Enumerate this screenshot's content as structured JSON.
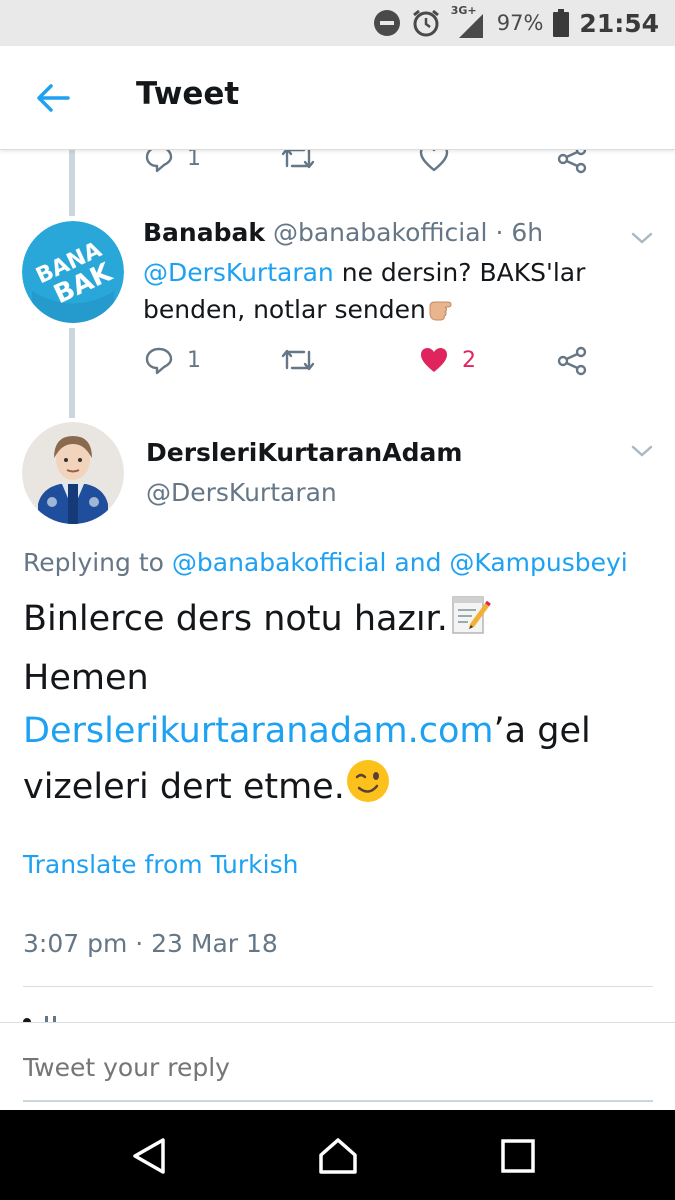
{
  "status_bar": {
    "network": "3G+",
    "battery": "97%",
    "time": "21:54"
  },
  "header": {
    "title": "Tweet",
    "back_icon": "arrow-left-icon"
  },
  "parent_actions": {
    "reply_count": "1"
  },
  "reply_tweet": {
    "name": "Banabak",
    "handle": "@banabakofficial",
    "time": "· 6h",
    "mention": "@DersKurtaran",
    "text_1": " ne dersin? BAKS'lar",
    "text_2": "benden, notlar senden",
    "emoji": "hand-pointing-icon",
    "avatar_text_1": "BANA",
    "avatar_text_2": "BAK",
    "reply_count": "1",
    "like_count": "2"
  },
  "main_tweet": {
    "name": "DersleriKurtaranAdam",
    "handle": "@DersKurtaran",
    "replying_prefix": "Replying to ",
    "replying_user_1": "@banabakofficial",
    "replying_and": " and ",
    "replying_user_2": "@Kampusbeyi",
    "text_line_1": "Binlerce ders notu hazır.",
    "text_line_2": "Hemen",
    "link": "Derslerikurtaranadam.com",
    "text_after_link": "’a gel",
    "text_line_4": "vizeleri dert etme.",
    "translate": "Translate from Turkish",
    "timestamp": "3:07 pm · 23 Mar 18"
  },
  "composer": {
    "placeholder": "Tweet your reply"
  },
  "colors": {
    "accent": "#1da1f2",
    "like": "#e0245e",
    "muted": "#657786"
  }
}
